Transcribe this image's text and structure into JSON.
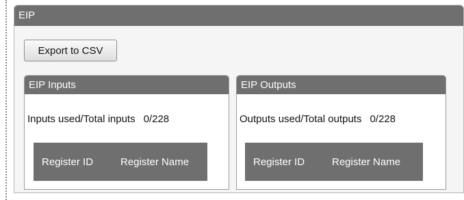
{
  "eip": {
    "title": "EIP",
    "export_button": "Export to CSV"
  },
  "inputs": {
    "title": "EIP Inputs",
    "usage_label": "Inputs used/Total inputs",
    "usage_value": "0/228",
    "columns": [
      "Register ID",
      "Register Name"
    ]
  },
  "outputs": {
    "title": "EIP Outputs",
    "usage_label": "Outputs used/Total outputs",
    "usage_value": "0/228",
    "columns": [
      "Register ID",
      "Register Name"
    ]
  },
  "colors": {
    "header_bg": "#6f6f6f",
    "panel_bg": "#f5f5f5"
  }
}
